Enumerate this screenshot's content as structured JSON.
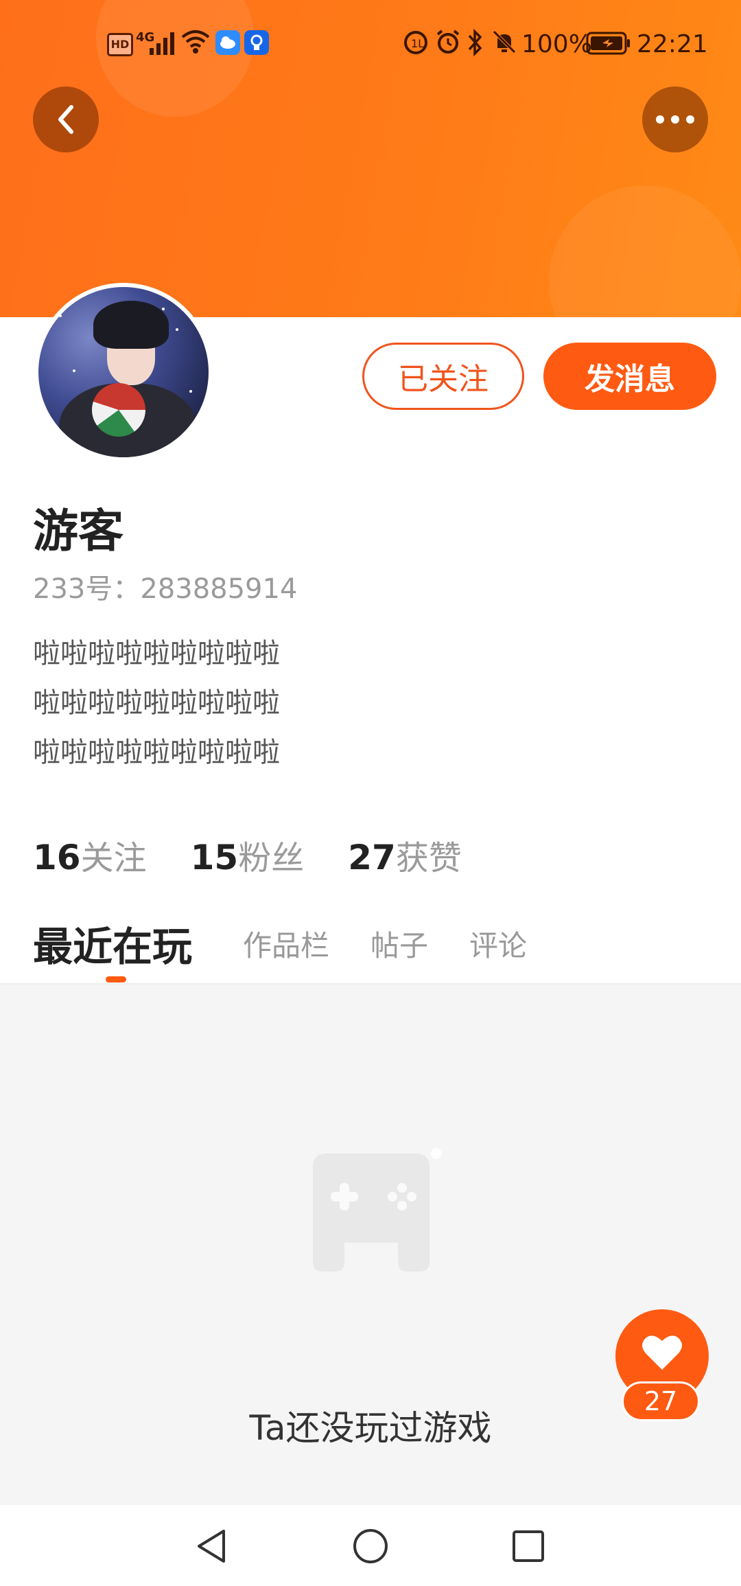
{
  "status_bar": {
    "hd_label": "HD",
    "network": "4G",
    "battery_percent": "100%",
    "time": "22:21"
  },
  "actions": {
    "followed_label": "已关注",
    "message_label": "发消息"
  },
  "profile": {
    "name": "游客",
    "id_line": "233号：283885914",
    "bio": [
      "啦啦啦啦啦啦啦啦啦",
      "啦啦啦啦啦啦啦啦啦",
      "啦啦啦啦啦啦啦啦啦"
    ]
  },
  "stats": [
    {
      "value": "16",
      "label": "关注"
    },
    {
      "value": "15",
      "label": "粉丝"
    },
    {
      "value": "27",
      "label": "获赞"
    }
  ],
  "tabs": [
    {
      "label": "最近在玩",
      "active": true
    },
    {
      "label": "作品栏",
      "active": false
    },
    {
      "label": "帖子",
      "active": false
    },
    {
      "label": "评论",
      "active": false
    }
  ],
  "empty_state": {
    "icon": "gamepad-icon",
    "message": "Ta还没玩过游戏"
  },
  "like_button": {
    "icon": "heart-icon",
    "count": "27"
  },
  "colors": {
    "accent": "#ff5a12",
    "banner": "#ff7a18"
  }
}
